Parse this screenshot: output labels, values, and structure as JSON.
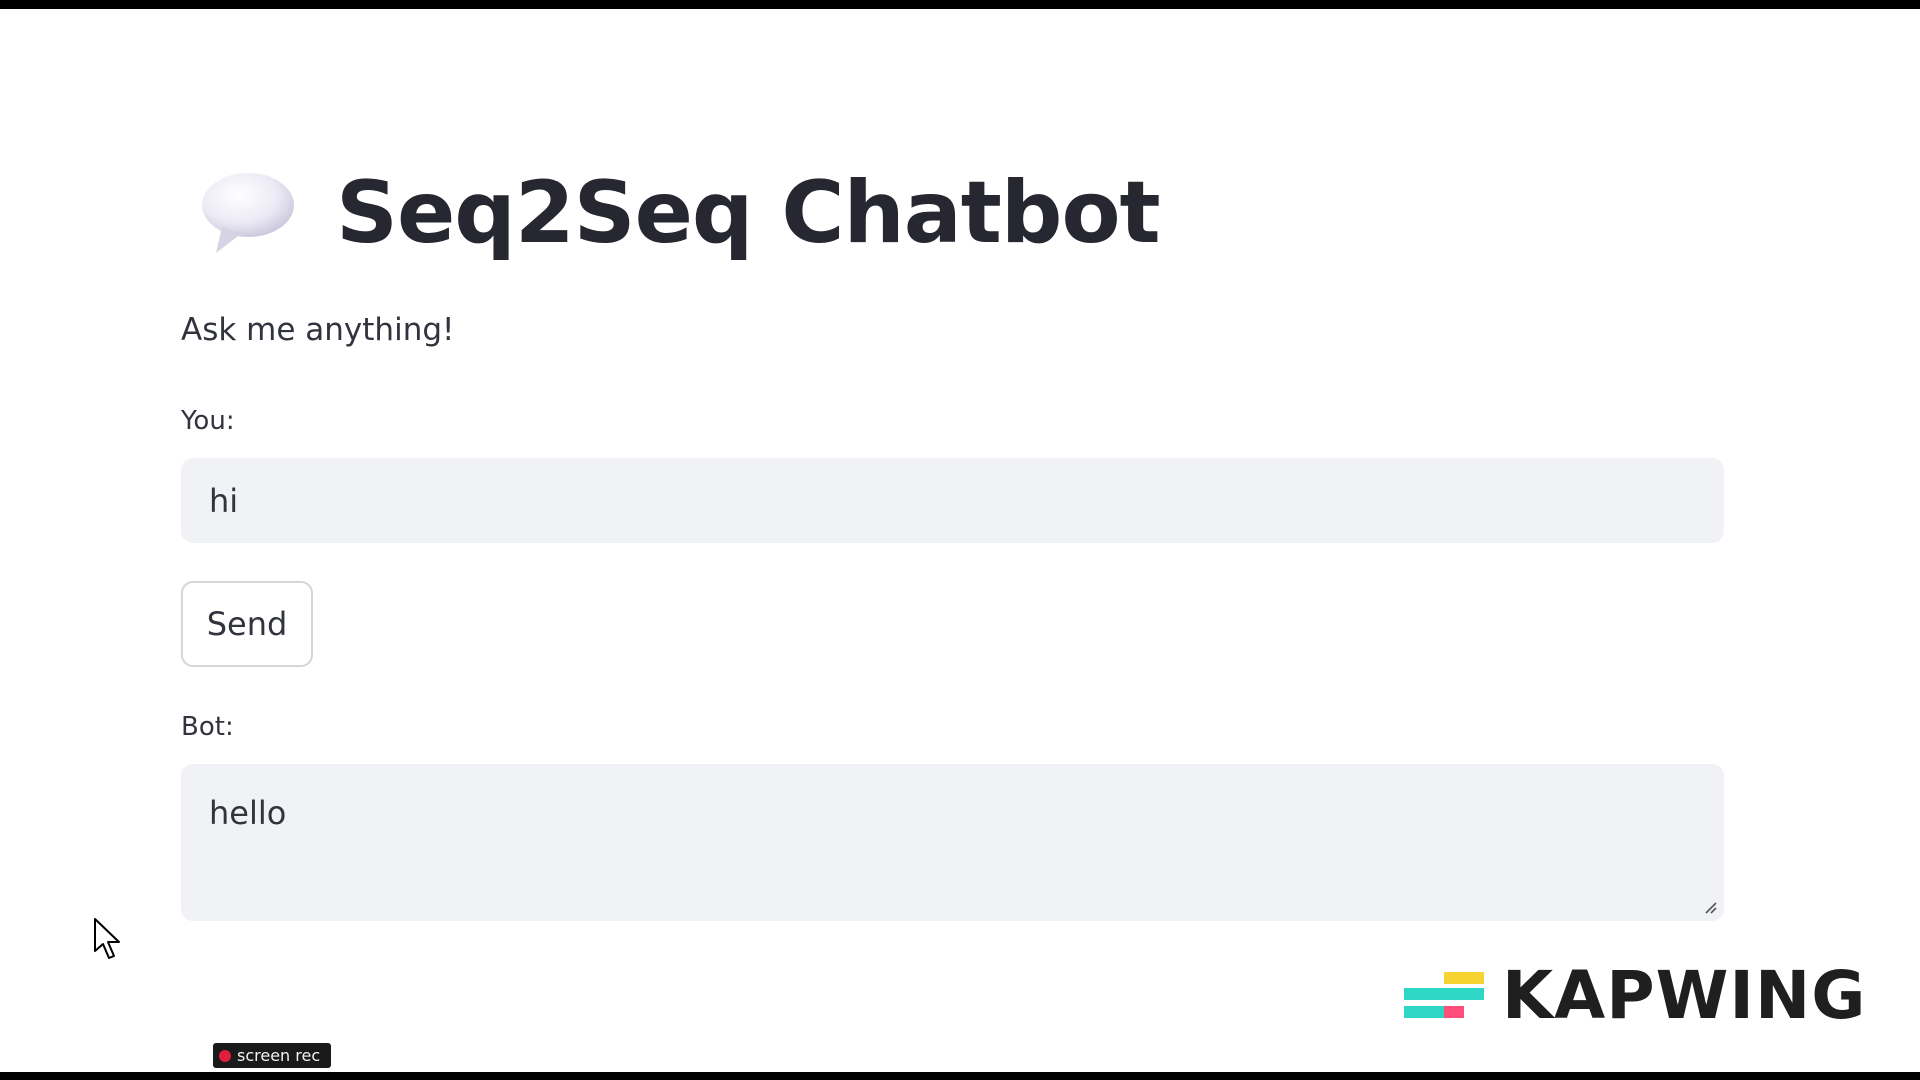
{
  "header": {
    "icon": "speech-balloon-icon",
    "title": "Seq2Seq Chatbot"
  },
  "subtitle": "Ask me anything!",
  "user_input": {
    "label": "You:",
    "value": "hi"
  },
  "send_button": {
    "label": "Send"
  },
  "bot_output": {
    "label": "Bot:",
    "value": "hello"
  },
  "watermark": {
    "brand": "KAPWING",
    "recorder": "screen rec"
  },
  "colors": {
    "input_bg": "#f0f2f6",
    "text": "#31333f",
    "title": "#262730",
    "record_red": "#e0203a"
  }
}
